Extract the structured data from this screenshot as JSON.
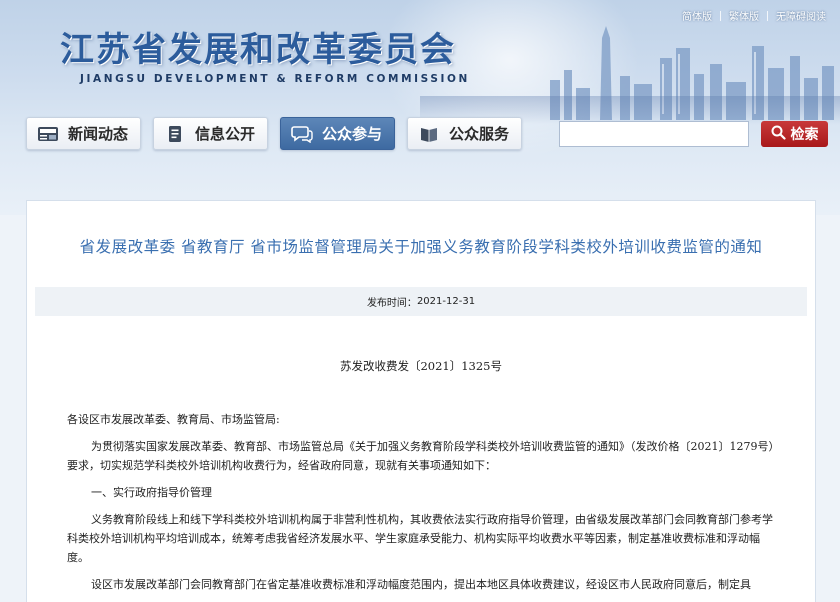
{
  "header": {
    "title": "江苏省发展和改革委员会",
    "subtitle": "JIANGSU DEVELOPMENT & REFORM COMMISSION",
    "top_links": [
      "简体版",
      "繁体版",
      "无障碍阅读"
    ]
  },
  "nav": {
    "items": [
      {
        "label": "新闻动态",
        "icon": "news-icon"
      },
      {
        "label": "信息公开",
        "icon": "document-icon"
      },
      {
        "label": "公众参与",
        "icon": "chat-icon"
      },
      {
        "label": "公众服务",
        "icon": "book-icon"
      }
    ],
    "active_index": 2
  },
  "search": {
    "placeholder": "",
    "button_label": "检索"
  },
  "article": {
    "title": "省发展改革委 省教育厅 省市场监督管理局关于加强义务教育阶段学科类校外培训收费监管的通知",
    "publish_label": "发布时间：",
    "publish_date": "2021-12-31",
    "doc_number": "苏发改收费发〔2021〕1325号",
    "paragraphs": [
      "各设区市发展改革委、教育局、市场监管局:",
      "为贯彻落实国家发展改革委、教育部、市场监管总局《关于加强义务教育阶段学科类校外培训收费监管的通知》（发改价格〔2021〕1279号）要求，切实规范学科类校外培训机构收费行为，经省政府同意，现就有关事项通知如下：",
      "一、实行政府指导价管理",
      "义务教育阶段线上和线下学科类校外培训机构属于非营利性机构，其收费依法实行政府指导价管理，由省级发展改革部门会同教育部门参考学科类校外培训机构平均培训成本，统筹考虑我省经济发展水平、学生家庭承受能力、机构实际平均收费水平等因素，制定基准收费标准和浮动幅度。",
      "设区市发展改革部门会同教育部门在省定基准收费标准和浮动幅度范围内，提出本地区具体收费建议，经设区市人民政府同意后，制定具"
    ]
  },
  "colors": {
    "title_blue": "#2c5c9c",
    "article_title": "#3a6fb0",
    "search_button": "#b3201f",
    "nav_active": "#4a76ad"
  }
}
